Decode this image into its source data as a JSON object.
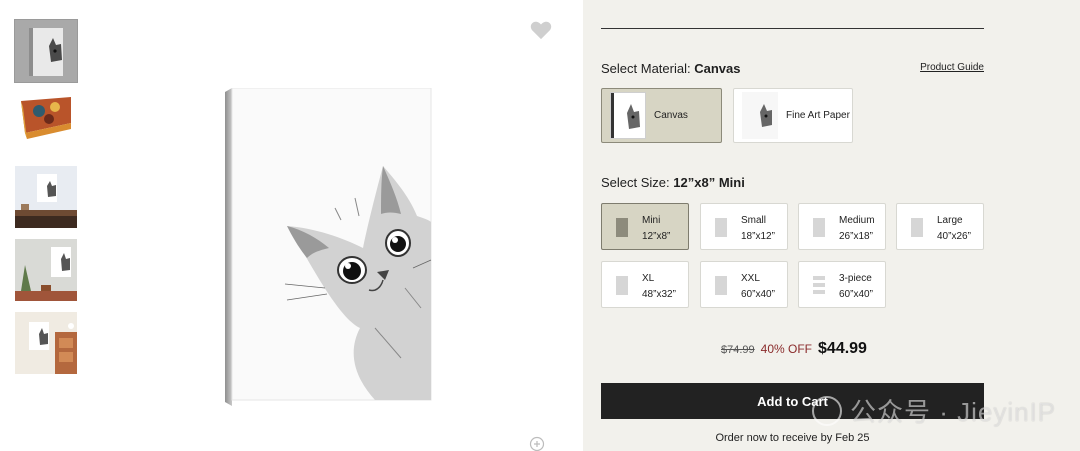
{
  "material": {
    "label": "Select Material:",
    "selected": "Canvas",
    "guide_link": "Product Guide",
    "options": [
      {
        "label": "Canvas",
        "selected": true
      },
      {
        "label": "Fine Art Paper",
        "selected": false
      }
    ]
  },
  "size": {
    "label": "Select Size:",
    "selected": "12”x8” Mini",
    "options": [
      {
        "name": "Mini",
        "dim": "12”x8”",
        "selected": true
      },
      {
        "name": "Small",
        "dim": "18”x12”",
        "selected": false
      },
      {
        "name": "Medium",
        "dim": "26”x18”",
        "selected": false
      },
      {
        "name": "Large",
        "dim": "40”x26”",
        "selected": false
      },
      {
        "name": "XL",
        "dim": "48”x32”",
        "selected": false
      },
      {
        "name": "XXL",
        "dim": "60”x40”",
        "selected": false
      },
      {
        "name": "3-piece",
        "dim": "60”x40”",
        "selected": false
      }
    ]
  },
  "pricing": {
    "original": "$74.99",
    "discount": "40% OFF",
    "current": "$44.99"
  },
  "cart_button": "Add to Cart",
  "shipping_note": "Order now to receive by Feb 25",
  "watermark": "公众号 · JieyinIP",
  "icons": {
    "favorite": "heart-icon",
    "zoom": "zoom-in-icon"
  },
  "colors": {
    "panel_bg": "#f2f1ec",
    "selected_bg": "#d7d5c4",
    "cart_bg": "#222222",
    "discount": "#8a2b2b"
  }
}
